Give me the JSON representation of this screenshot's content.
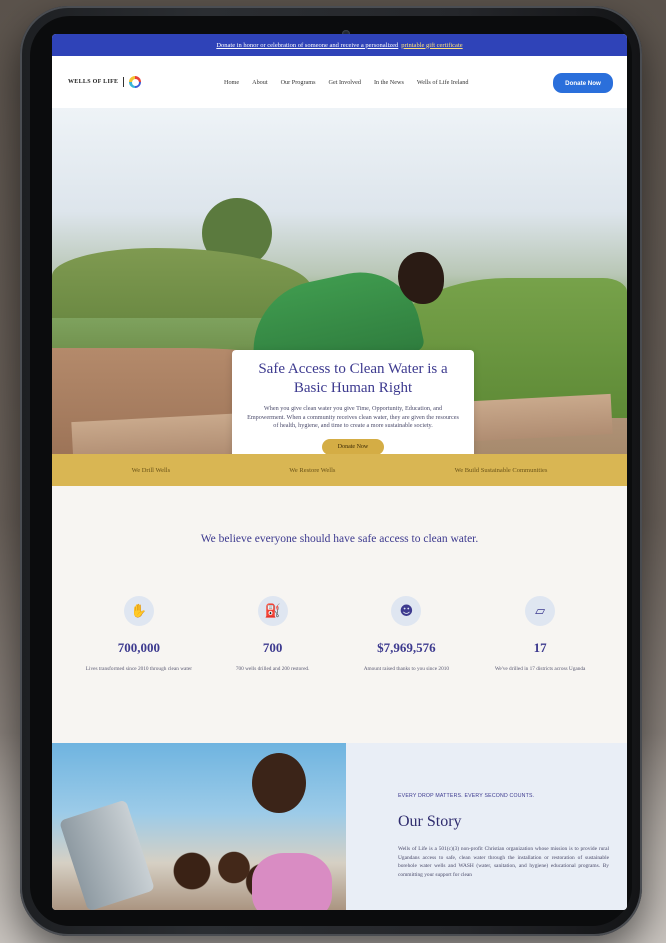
{
  "announce": {
    "text": "Donate in honor or celebration of someone and receive a personalized",
    "link": "printable gift certificate"
  },
  "header": {
    "brand": "WELLS OF LIFE",
    "nav": [
      "Home",
      "About",
      "Our Programs",
      "Get Involved",
      "In the News",
      "Wells of Life Ireland"
    ],
    "donate": "Donate Now"
  },
  "hero": {
    "title": "Safe Access to Clean Water is a Basic Human Right",
    "body": "When you give clean water you give Time, Opportunity, Education, and Empowerment. When a community receives clean water, they are given the resources of health, hygiene, and time to create a more sustainable society.",
    "button": "Donate Now"
  },
  "band": [
    "We Drill Wells",
    "We Restore Wells",
    "We Build Sustainable Communities"
  ],
  "mission": {
    "headline": "We believe everyone should have safe access to clean water.",
    "stats": [
      {
        "icon": "hand-water-icon",
        "number": "700,000",
        "desc": "Lives transformed since 2010 through clean water"
      },
      {
        "icon": "jerrycan-icon",
        "number": "700",
        "desc": "700 wells drilled and 200 restored."
      },
      {
        "icon": "people-icon",
        "number": "$7,969,576",
        "desc": "Amount raised thanks to you since 2010"
      },
      {
        "icon": "uganda-map-icon",
        "number": "17",
        "desc": "We've drilled in 17 districts across Uganda"
      }
    ]
  },
  "story": {
    "kicker": "EVERY DROP MATTERS. EVERY SECOND COUNTS.",
    "title": "Our Story",
    "body": "Wells of Life is a 501(c)(3) non-profit Christian organization whose mission is to provide rural Ugandans access to safe, clean water through the installation or restoration of sustainable borehole water wells and WASH (water, sanitation, and hygiene) educational programs. By committing your support for clean"
  }
}
